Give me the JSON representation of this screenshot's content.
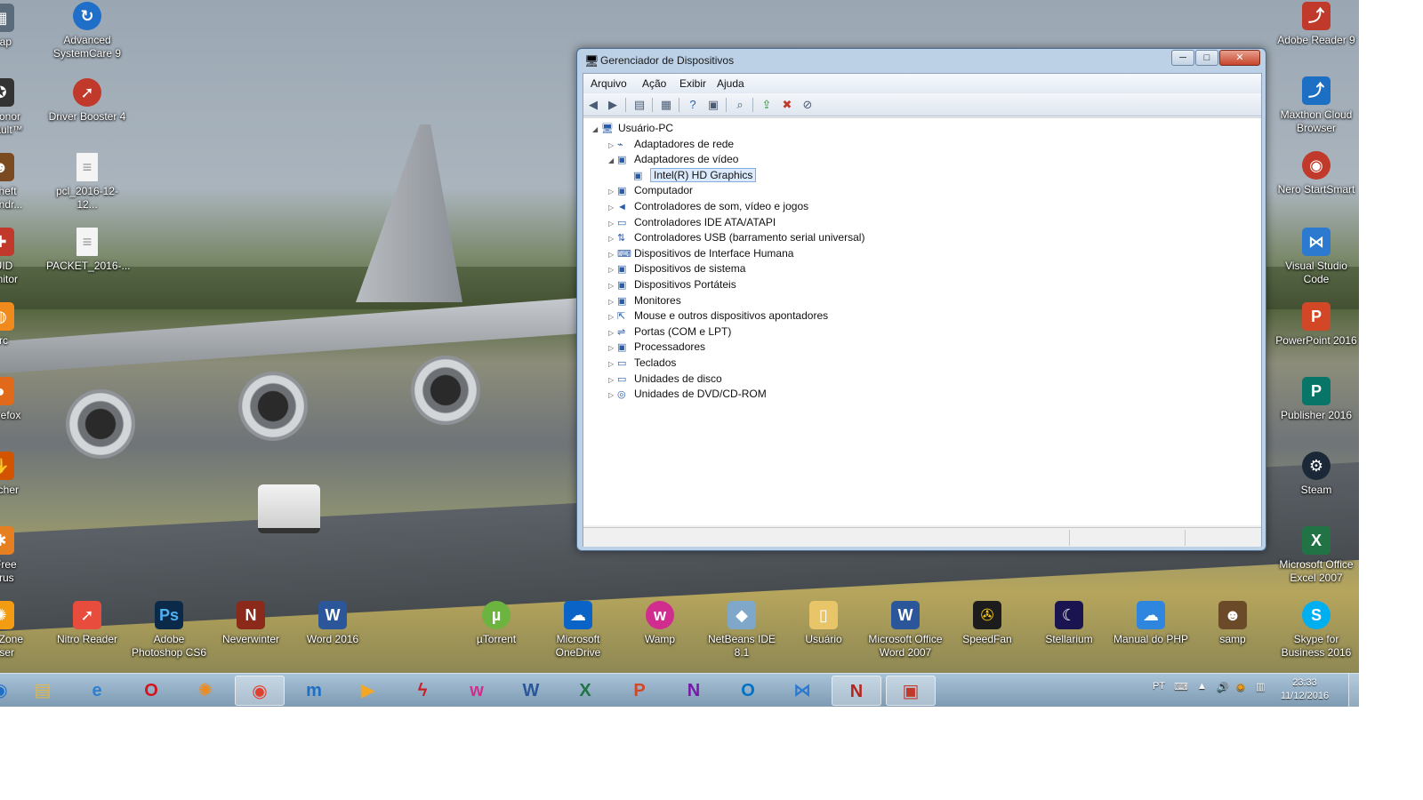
{
  "desktop": {
    "left_icons": [
      {
        "label": "ncap",
        "icon": "app-icon"
      },
      {
        "label": "of Honor\nAssault™",
        "icon": "game-icon"
      },
      {
        "label": "d Theft\nan Andr...",
        "icon": "game-icon"
      },
      {
        "label": "PUID\nMonitor",
        "icon": "monitor-icon"
      },
      {
        "label": "Arc",
        "icon": "arc-icon"
      },
      {
        "label": "a Firefox",
        "icon": "firefox-icon"
      },
      {
        "label": "Catcher",
        "icon": "catcher-icon"
      },
      {
        "label": "st Free\ntivirus",
        "icon": "antivirus-icon"
      },
      {
        "label": "SafeZone\nowser",
        "icon": "browser-icon"
      }
    ],
    "second_col_icons": [
      {
        "label": "Advanced\nSystemCare 9",
        "icon": "systemcare-icon"
      },
      {
        "label": "Driver Booster 4",
        "icon": "driverbooster-icon"
      },
      {
        "label": "pcl_2016-12-12...",
        "icon": "file-icon"
      },
      {
        "label": "PACKET_2016-...",
        "icon": "file-icon"
      }
    ],
    "bottom_icons": [
      {
        "label": "Nitro Reader",
        "icon": "nitro-icon"
      },
      {
        "label": "Adobe\nPhotoshop CS6",
        "icon": "photoshop-icon"
      },
      {
        "label": "Neverwinter",
        "icon": "neverwinter-icon"
      },
      {
        "label": "Word 2016",
        "icon": "word-icon"
      },
      {
        "label": "µTorrent",
        "icon": "utorrent-icon"
      },
      {
        "label": "Microsoft\nOneDrive",
        "icon": "onedrive-icon"
      },
      {
        "label": "Wamp",
        "icon": "wamp-icon"
      },
      {
        "label": "NetBeans IDE 8.1",
        "icon": "netbeans-icon"
      },
      {
        "label": "Usuário",
        "icon": "folder-icon"
      },
      {
        "label": "Microsoft Office\nWord 2007",
        "icon": "word-icon"
      },
      {
        "label": "SpeedFan",
        "icon": "speedfan-icon"
      },
      {
        "label": "Stellarium",
        "icon": "stellarium-icon"
      },
      {
        "label": "Manual do PHP",
        "icon": "php-icon"
      },
      {
        "label": "samp",
        "icon": "samp-icon"
      }
    ],
    "right_icons": [
      {
        "label": "Adobe Reader 9",
        "icon": "pdf-icon"
      },
      {
        "label": "Maxthon Cloud\nBrowser",
        "icon": "maxthon-icon"
      },
      {
        "label": "Nero StartSmart",
        "icon": "nero-icon"
      },
      {
        "label": "Visual Studio\nCode",
        "icon": "vscode-icon"
      },
      {
        "label": "PowerPoint 2016",
        "icon": "powerpoint-icon"
      },
      {
        "label": "Publisher 2016",
        "icon": "publisher-icon"
      },
      {
        "label": "Steam",
        "icon": "steam-icon"
      },
      {
        "label": "Microsoft Office\nExcel 2007",
        "icon": "excel-icon"
      },
      {
        "label": "Skype for\nBusiness 2016",
        "icon": "skype-icon"
      }
    ]
  },
  "window": {
    "title": "Gerenciador de Dispositivos",
    "controls": {
      "minimize": "─",
      "maximize": "□",
      "close": "✕"
    },
    "menu": [
      "Arquivo",
      "Ação",
      "Exibir",
      "Ajuda"
    ],
    "tree": {
      "root": "Usuário-PC",
      "items": [
        {
          "label": "Adaptadores de rede",
          "expanded": false
        },
        {
          "label": "Adaptadores de vídeo",
          "expanded": true,
          "children": [
            "Intel(R) HD Graphics"
          ]
        },
        {
          "label": "Computador",
          "expanded": false
        },
        {
          "label": "Controladores de som, vídeo e jogos",
          "expanded": false
        },
        {
          "label": "Controladores IDE ATA/ATAPI",
          "expanded": false
        },
        {
          "label": "Controladores USB (barramento serial universal)",
          "expanded": false
        },
        {
          "label": "Dispositivos de Interface Humana",
          "expanded": false
        },
        {
          "label": "Dispositivos de sistema",
          "expanded": false
        },
        {
          "label": "Dispositivos Portáteis",
          "expanded": false
        },
        {
          "label": "Monitores",
          "expanded": false
        },
        {
          "label": "Mouse e outros dispositivos apontadores",
          "expanded": false
        },
        {
          "label": "Portas (COM e LPT)",
          "expanded": false
        },
        {
          "label": "Processadores",
          "expanded": false
        },
        {
          "label": "Teclados",
          "expanded": false
        },
        {
          "label": "Unidades de disco",
          "expanded": false
        },
        {
          "label": "Unidades de DVD/CD-ROM",
          "expanded": false
        }
      ]
    }
  },
  "taskbar": {
    "buttons": [
      {
        "name": "explorer",
        "glyph": "▤",
        "color": "#e0b84a"
      },
      {
        "name": "internet-explorer",
        "glyph": "e",
        "color": "#2f7fd0"
      },
      {
        "name": "opera",
        "glyph": "O",
        "color": "#d2161e"
      },
      {
        "name": "safezone",
        "glyph": "✺",
        "color": "#f08a1c"
      },
      {
        "name": "chrome",
        "glyph": "◉",
        "color": "#e2402f",
        "active": true
      },
      {
        "name": "maxthon",
        "glyph": "m",
        "color": "#1d6fc4"
      },
      {
        "name": "media",
        "glyph": "▶",
        "color": "#f5a623"
      },
      {
        "name": "flash",
        "glyph": "ϟ",
        "color": "#c8202a"
      },
      {
        "name": "wamp",
        "glyph": "w",
        "color": "#d12d8e"
      },
      {
        "name": "word",
        "glyph": "W",
        "color": "#2b579a"
      },
      {
        "name": "excel",
        "glyph": "X",
        "color": "#217346"
      },
      {
        "name": "powerpoint",
        "glyph": "P",
        "color": "#d24726"
      },
      {
        "name": "onenote",
        "glyph": "N",
        "color": "#7719aa"
      },
      {
        "name": "outlook",
        "glyph": "O",
        "color": "#0072c6"
      },
      {
        "name": "vscode",
        "glyph": "⋈",
        "color": "#2b7ad0"
      },
      {
        "name": "neverwinter",
        "glyph": "N",
        "color": "#b3261e",
        "active": true
      },
      {
        "name": "device-manager",
        "glyph": "▣",
        "color": "#c0392b",
        "active": true
      }
    ],
    "lang": "PT",
    "time": "23:33",
    "date": "11/12/2016"
  }
}
